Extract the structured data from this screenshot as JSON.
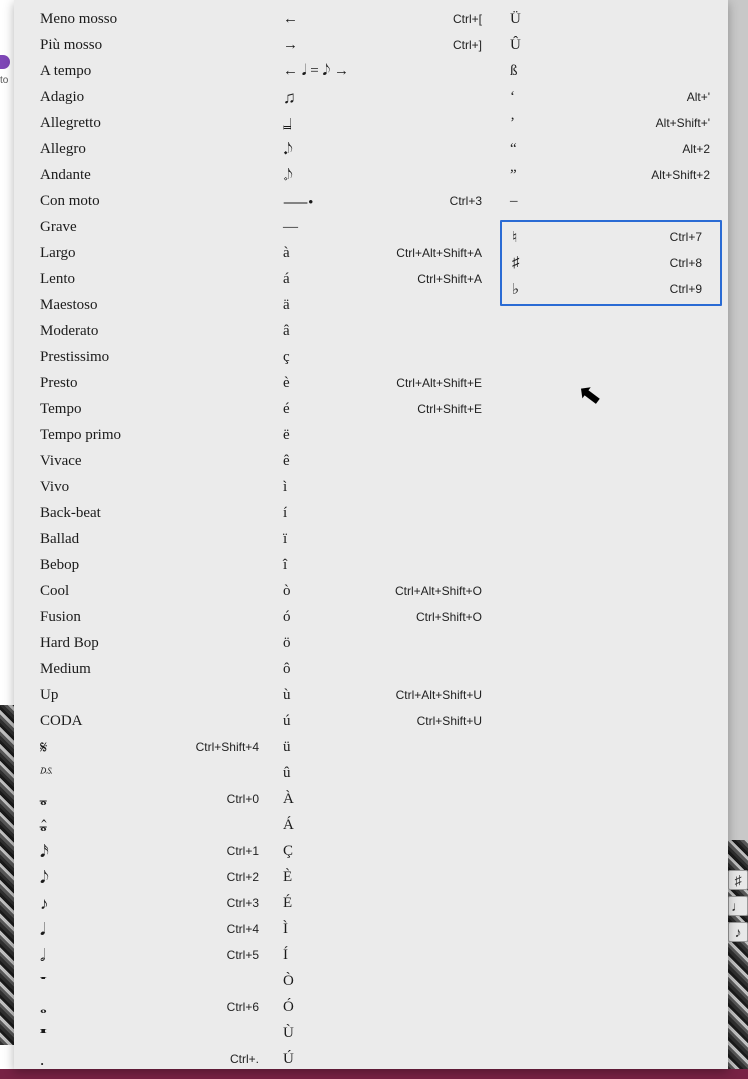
{
  "col1": [
    {
      "label": "Meno mosso",
      "sc": ""
    },
    {
      "label": "Più mosso",
      "sc": ""
    },
    {
      "label": "A tempo",
      "sc": ""
    },
    {
      "label": "Adagio",
      "sc": ""
    },
    {
      "label": "Allegretto",
      "sc": ""
    },
    {
      "label": "Allegro",
      "sc": ""
    },
    {
      "label": "Andante",
      "sc": ""
    },
    {
      "label": "Con moto",
      "sc": ""
    },
    {
      "label": "Grave",
      "sc": ""
    },
    {
      "label": "Largo",
      "sc": ""
    },
    {
      "label": "Lento",
      "sc": ""
    },
    {
      "label": "Maestoso",
      "sc": ""
    },
    {
      "label": "Moderato",
      "sc": ""
    },
    {
      "label": "Prestissimo",
      "sc": ""
    },
    {
      "label": "Presto",
      "sc": ""
    },
    {
      "label": "Tempo",
      "sc": ""
    },
    {
      "label": "Tempo primo",
      "sc": ""
    },
    {
      "label": "Vivace",
      "sc": ""
    },
    {
      "label": "Vivo",
      "sc": ""
    },
    {
      "label": "Back-beat",
      "sc": ""
    },
    {
      "label": "Ballad",
      "sc": ""
    },
    {
      "label": "Bebop",
      "sc": ""
    },
    {
      "label": "Cool",
      "sc": ""
    },
    {
      "label": "Fusion",
      "sc": ""
    },
    {
      "label": "Hard Bop",
      "sc": ""
    },
    {
      "label": "Medium",
      "sc": ""
    },
    {
      "label": "Up",
      "sc": ""
    },
    {
      "label": "CODA",
      "sc": ""
    },
    {
      "label": "𝄋",
      "sc": "Ctrl+Shift+4",
      "mus": true
    },
    {
      "label": "𝄉",
      "sc": "",
      "mus": true
    },
    {
      "label": "𝅝̶",
      "sc": "Ctrl+0",
      "mus": true
    },
    {
      "label": "𝅝̶̂",
      "sc": "",
      "mus": true
    },
    {
      "label": "𝅘𝅥𝅯",
      "sc": "Ctrl+1",
      "mus": true
    },
    {
      "label": "𝅘𝅥𝅮",
      "sc": "Ctrl+2",
      "mus": true
    },
    {
      "label": "♪",
      "sc": "Ctrl+3",
      "mus": true
    },
    {
      "label": "𝅘𝅥",
      "sc": "Ctrl+4",
      "mus": true
    },
    {
      "label": "𝅗𝅥",
      "sc": "Ctrl+5",
      "mus": true
    },
    {
      "label": "𝄻",
      "sc": "",
      "mus": true
    },
    {
      "label": "𝅝",
      "sc": "Ctrl+6",
      "mus": true
    },
    {
      "label": "𝄺",
      "sc": "",
      "mus": true
    },
    {
      "label": ".",
      "sc": "Ctrl+.",
      "mus": true
    }
  ],
  "col2": [
    {
      "label": "←",
      "sc": "Ctrl+["
    },
    {
      "label": "→",
      "sc": "Ctrl+]"
    },
    {
      "label": "← 𝅘𝅥 = 𝅘𝅥𝅮 →",
      "sc": ""
    },
    {
      "label": "♫",
      "sc": "",
      "mus": true
    },
    {
      "label": "𝆶",
      "sc": "",
      "mus": true
    },
    {
      "label": "𝆺𝅥𝅮",
      "sc": "",
      "mus": true
    },
    {
      "label": "𝆹𝅥𝅮",
      "sc": "",
      "mus": true
    },
    {
      "label": "⸺•",
      "sc": "Ctrl+3"
    },
    {
      "label": "—",
      "sc": ""
    },
    {
      "label": "à",
      "sc": "Ctrl+Alt+Shift+A"
    },
    {
      "label": "á",
      "sc": "Ctrl+Shift+A"
    },
    {
      "label": "ä",
      "sc": ""
    },
    {
      "label": "â",
      "sc": ""
    },
    {
      "label": "ç",
      "sc": ""
    },
    {
      "label": "è",
      "sc": "Ctrl+Alt+Shift+E"
    },
    {
      "label": "é",
      "sc": "Ctrl+Shift+E"
    },
    {
      "label": "ë",
      "sc": ""
    },
    {
      "label": "ê",
      "sc": ""
    },
    {
      "label": "ì",
      "sc": ""
    },
    {
      "label": "í",
      "sc": ""
    },
    {
      "label": "ï",
      "sc": ""
    },
    {
      "label": "î",
      "sc": ""
    },
    {
      "label": "ò",
      "sc": "Ctrl+Alt+Shift+O"
    },
    {
      "label": "ó",
      "sc": "Ctrl+Shift+O"
    },
    {
      "label": "ö",
      "sc": ""
    },
    {
      "label": "ô",
      "sc": ""
    },
    {
      "label": "ù",
      "sc": "Ctrl+Alt+Shift+U"
    },
    {
      "label": "ú",
      "sc": "Ctrl+Shift+U"
    },
    {
      "label": "ü",
      "sc": ""
    },
    {
      "label": "û",
      "sc": ""
    },
    {
      "label": "À",
      "sc": ""
    },
    {
      "label": "Á",
      "sc": ""
    },
    {
      "label": "Ç",
      "sc": ""
    },
    {
      "label": "È",
      "sc": ""
    },
    {
      "label": "É",
      "sc": ""
    },
    {
      "label": "Ì",
      "sc": ""
    },
    {
      "label": "Í",
      "sc": ""
    },
    {
      "label": "Ò",
      "sc": ""
    },
    {
      "label": "Ó",
      "sc": ""
    },
    {
      "label": "Ù",
      "sc": ""
    },
    {
      "label": "Ú",
      "sc": ""
    }
  ],
  "col3_top": [
    {
      "label": "Ü",
      "sc": ""
    },
    {
      "label": "Û",
      "sc": ""
    },
    {
      "label": "ß",
      "sc": ""
    },
    {
      "label": "‘",
      "sc": "Alt+'"
    },
    {
      "label": "’",
      "sc": "Alt+Shift+'"
    },
    {
      "label": "“",
      "sc": "Alt+2"
    },
    {
      "label": "”",
      "sc": "Alt+Shift+2"
    },
    {
      "label": "–",
      "sc": ""
    }
  ],
  "col3_highlight": [
    {
      "label": "♮",
      "sc": "Ctrl+7"
    },
    {
      "label": "♯",
      "sc": "Ctrl+8"
    },
    {
      "label": "♭",
      "sc": "Ctrl+9"
    }
  ]
}
